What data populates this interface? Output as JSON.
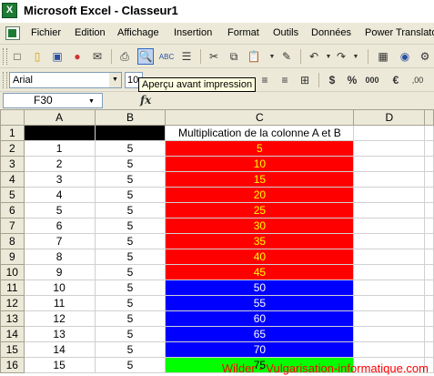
{
  "window": {
    "title": "Microsoft Excel - Classeur1"
  },
  "menu": [
    "Fichier",
    "Edition",
    "Affichage",
    "Insertion",
    "Format",
    "Outils",
    "Données",
    "Power Translato"
  ],
  "format_bar": {
    "font": "Arial",
    "size": "10"
  },
  "tooltip": "Aperçu avant impression",
  "formula_bar": {
    "cell_ref": "F30",
    "fx": "fx",
    "content": ""
  },
  "columns": [
    "A",
    "B",
    "C",
    "D"
  ],
  "header_c1": "Multiplication de la colonne A et B",
  "rows": [
    {
      "n": "1",
      "a": "",
      "b": "",
      "c": "Multiplication de la colonne A et B"
    },
    {
      "n": "2",
      "a": "1",
      "b": "5",
      "c": "5"
    },
    {
      "n": "3",
      "a": "2",
      "b": "5",
      "c": "10"
    },
    {
      "n": "4",
      "a": "3",
      "b": "5",
      "c": "15"
    },
    {
      "n": "5",
      "a": "4",
      "b": "5",
      "c": "20"
    },
    {
      "n": "6",
      "a": "5",
      "b": "5",
      "c": "25"
    },
    {
      "n": "7",
      "a": "6",
      "b": "5",
      "c": "30"
    },
    {
      "n": "8",
      "a": "7",
      "b": "5",
      "c": "35"
    },
    {
      "n": "9",
      "a": "8",
      "b": "5",
      "c": "40"
    },
    {
      "n": "10",
      "a": "9",
      "b": "5",
      "c": "45"
    },
    {
      "n": "11",
      "a": "10",
      "b": "5",
      "c": "50"
    },
    {
      "n": "12",
      "a": "11",
      "b": "5",
      "c": "55"
    },
    {
      "n": "13",
      "a": "12",
      "b": "5",
      "c": "60"
    },
    {
      "n": "14",
      "a": "13",
      "b": "5",
      "c": "65"
    },
    {
      "n": "15",
      "a": "14",
      "b": "5",
      "c": "70"
    },
    {
      "n": "16",
      "a": "15",
      "b": "5",
      "c": "75"
    }
  ],
  "colors": {
    "red": "#ff0000",
    "blue": "#0000ff",
    "green": "#00ff00",
    "yellow_text": "#ffff00"
  },
  "watermark": "Wilder - Vulgarisation-informatique.com"
}
